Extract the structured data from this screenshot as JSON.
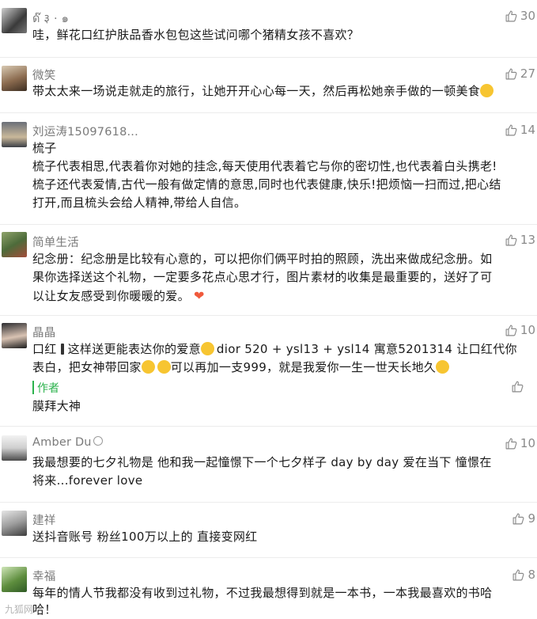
{
  "comments": [
    {
      "name": "ด๊ ३ · ๑",
      "likes": "30",
      "text": "哇，鲜花口红护肤品香水包包这些试问哪个猪精女孩不喜欢？"
    },
    {
      "name": "微笑",
      "likes": "27",
      "text": "带太太来一场说走就走的旅行，让她开开心心每一天，然后再松她亲手做的一顿美食"
    },
    {
      "name": "刘运涛15097618...",
      "likes": "14",
      "lines": [
        "梳子",
        "梳子代表相思,代表着你对她的挂念,每天使用代表着它与你的密切性,也代表着白头携老!",
        "梳子还代表爱情,古代一般有做定情的意思,同时也代表健康,快乐!把烦恼一扫而过,把心结",
        "打开,而且梳头会给人精神,带给人自信。"
      ]
    },
    {
      "name": "简单生活",
      "likes": "13",
      "lines": [
        "纪念册：纪念册是比较有心意的，可以把你们俩平时拍的照顾，洗出来做成纪念册。如",
        "果你选择送这个礼物，一定要多花点心思才行，图片素材的收集是最重要的，送好了可",
        "以让女友感受到你暖暖的爱。"
      ]
    },
    {
      "name": "晶晶",
      "likes": "10",
      "line1a": "口红",
      "line1b": "这样送更能表达你的爱意",
      "line1c": "dior 520 + ysl13 + ysl14 寓意5201314 让口红代你",
      "line2a": "表白，把女神带回家",
      "line2b": "可以再加一支999，就是我爱你一生一世天长地久",
      "reply_label": "作者",
      "reply_text": "膜拜大神"
    },
    {
      "name": "Amber Du",
      "likes": "10",
      "lines": [
        "我最想要的七夕礼物是 他和我一起憧憬下一个七夕样子 day by day 爱在当下 憧憬在",
        "将来...forever love"
      ]
    },
    {
      "name": "建祥",
      "likes": "9",
      "text": "送抖音账号 粉丝100万以上的 直接变网红"
    },
    {
      "name": "幸福",
      "likes": "8",
      "lines": [
        "每年的情人节我都没有收到过礼物，不过我最想得到就是一本书，一本我最喜欢的书哈",
        "哈！"
      ]
    }
  ],
  "watermark": "九狐网",
  "colors": {
    "author_green": "#2bb24c",
    "like_gray": "#8a8a8a",
    "name_gray": "#7a7a7a"
  }
}
